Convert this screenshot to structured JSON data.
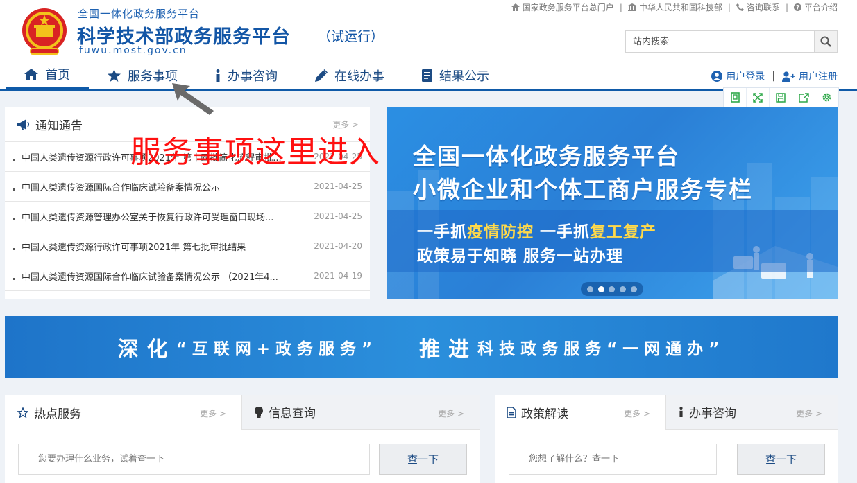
{
  "header": {
    "platform_small": "全国一体化政务服务平台",
    "platform_main": "科学技术部政务服务平台",
    "platform_trial": "（试运行）",
    "url": "fuwu.most.gov.cn"
  },
  "top_links": [
    {
      "label": "国家政务服务平台总门户",
      "icon": "home-icon"
    },
    {
      "label": "中华人民共和国科技部",
      "icon": "building-icon"
    },
    {
      "label": "咨询联系",
      "icon": "phone-icon"
    },
    {
      "label": "平台介绍",
      "icon": "question-icon"
    }
  ],
  "search": {
    "placeholder": "站内搜索",
    "icon": "search-icon"
  },
  "nav": [
    {
      "label": "首页",
      "icon": "home-icon",
      "active": true
    },
    {
      "label": "服务事项",
      "icon": "star-icon"
    },
    {
      "label": "办事咨询",
      "icon": "info-icon"
    },
    {
      "label": "在线办事",
      "icon": "pencil-icon"
    },
    {
      "label": "结果公示",
      "icon": "book-icon"
    }
  ],
  "user_links": {
    "login": "用户登录",
    "register": "用户注册"
  },
  "toolbar_icons": [
    "bookmark-icon",
    "fullscreen-icon",
    "save-icon",
    "share-icon",
    "settings-icon"
  ],
  "notice": {
    "title": "通知通告",
    "more": "更多 >",
    "items": [
      {
        "text": "中国人类遗传资源行政许可事项2021年 第十四批简化流程审批...",
        "date": "2021-04-25"
      },
      {
        "text": "中国人类遗传资源国际合作临床试验备案情况公示",
        "date": "2021-04-25"
      },
      {
        "text": "中国人类遗传资源管理办公室关于恢复行政许可受理窗口现场...",
        "date": "2021-04-25"
      },
      {
        "text": "中国人类遗传资源行政许可事项2021年 第七批审批结果",
        "date": "2021-04-20"
      },
      {
        "text": "中国人类遗传资源国际合作临床试验备案情况公示 （2021年4...",
        "date": "2021-04-19"
      }
    ]
  },
  "banner": {
    "line1": "全国一体化政务服务平台",
    "line2": "小微企业和个体工商户服务专栏",
    "line3_a": "一手抓",
    "line3_hl1": "疫情防控",
    "line3_b": " 一手抓",
    "line3_hl2": "复工复产",
    "line4": "政策易于知晓 服务一站办理",
    "slide_count": 5,
    "active_slide": 2
  },
  "slogan": {
    "part1_big": "深化",
    "part1_small": "“互联网+政务服务”",
    "part2_big": "推进",
    "part2_small": "科技政务服务“一网通办”"
  },
  "left_panel": {
    "tab1": {
      "label": "热点服务",
      "more": "更多 >"
    },
    "tab2": {
      "label": "信息查询",
      "more": "更多 >"
    },
    "input_placeholder": "您要办理什么业务，试着查一下",
    "button": "查一下"
  },
  "right_panel": {
    "tab1": {
      "label": "政策解读",
      "more": "更多 >"
    },
    "tab2": {
      "label": "办事咨询",
      "more": "更多 >"
    },
    "input_placeholder": "您想了解什么？查一下",
    "button": "查一下"
  },
  "annotation": {
    "text": "服务事项这里进入",
    "color": "#ff1010"
  },
  "colors": {
    "brand": "#1356a6",
    "nav_text": "#1c4b84",
    "banner_blue": "#2b8fe3",
    "highlight": "#ffd94a"
  }
}
